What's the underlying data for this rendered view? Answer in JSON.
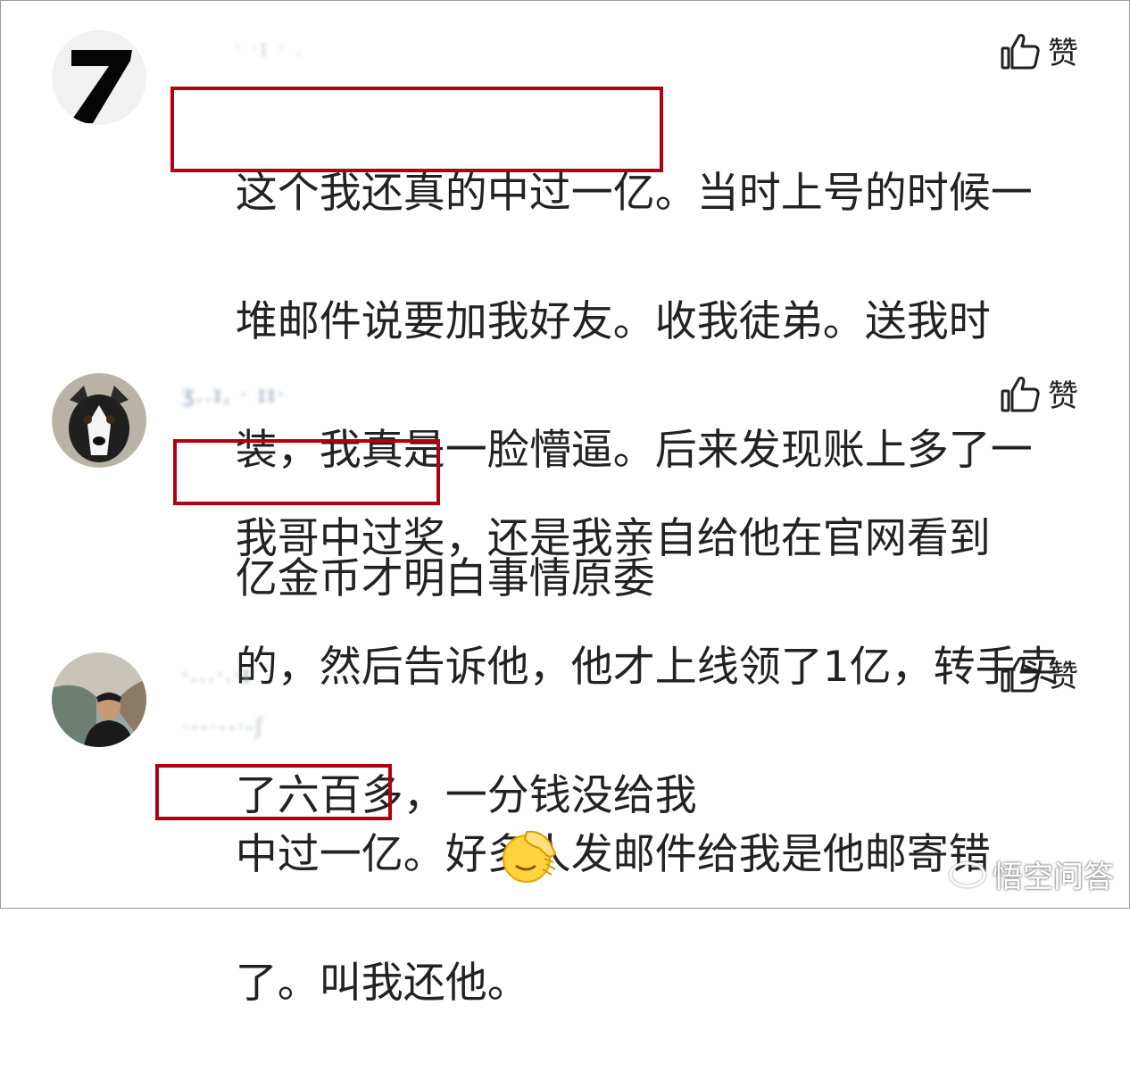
{
  "comments": [
    {
      "username": "· ·ɪ        · .",
      "like_label": "赞",
      "highlight": "这个我还真的中过一亿。",
      "lines": [
        "当时上号的时候一",
        "堆邮件说要加我好友。收我徒弟。送我时",
        "装，我真是一脸懵逼。后来发现账上多了一",
        "亿金币才明白事情原委"
      ]
    },
    {
      "username": "ʒ..ɪ, · ɪɪ·",
      "like_label": "赞",
      "highlight": "我哥中过奖，",
      "lines": [
        "还是我亲自给他在官网看到",
        "的，然后告诉他，他才上线领了1亿，转手卖",
        "了六百多，一分钱没给我"
      ]
    },
    {
      "username": "·...·.·ɪ",
      "username2": "·--·--·-ʃ",
      "like_label": "赞",
      "highlight": "中过一亿。",
      "lines": [
        "好多人发邮件给我是他邮寄错",
        "了。叫我还他。"
      ]
    }
  ],
  "watermark": {
    "text": "悟空问答"
  },
  "colors": {
    "highlight_border": "#b00012",
    "text": "#222222"
  },
  "icons": [
    "thumbs-up-icon",
    "facepalm-emoji-icon",
    "wukong-logo-icon"
  ]
}
